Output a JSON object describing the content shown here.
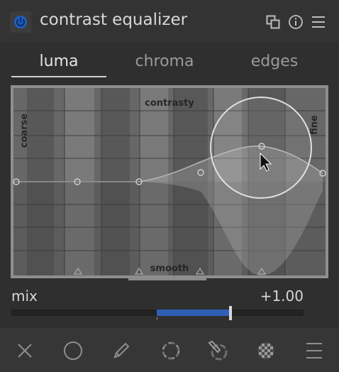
{
  "header": {
    "title": "contrast equalizer",
    "accent_color": "#1f5fbf",
    "icons": [
      "power-icon",
      "presets-icon",
      "info-icon",
      "menu-icon"
    ]
  },
  "tabs": [
    {
      "label": "luma",
      "active": true
    },
    {
      "label": "chroma",
      "active": false
    },
    {
      "label": "edges",
      "active": false
    }
  ],
  "graph": {
    "label_top": "contrasty",
    "label_bottom": "smooth",
    "label_left": "coarse",
    "label_right": "fine"
  },
  "mix": {
    "label": "mix",
    "value_text": "+1.00",
    "value": 1.0,
    "fill_color": "#2f5fb4"
  },
  "footer": {
    "icons": [
      "close-icon",
      "circle-icon",
      "pencil-icon",
      "brush-dash-icon",
      "pencil-brush-icon",
      "checker-icon",
      "hamburger-icon"
    ]
  }
}
